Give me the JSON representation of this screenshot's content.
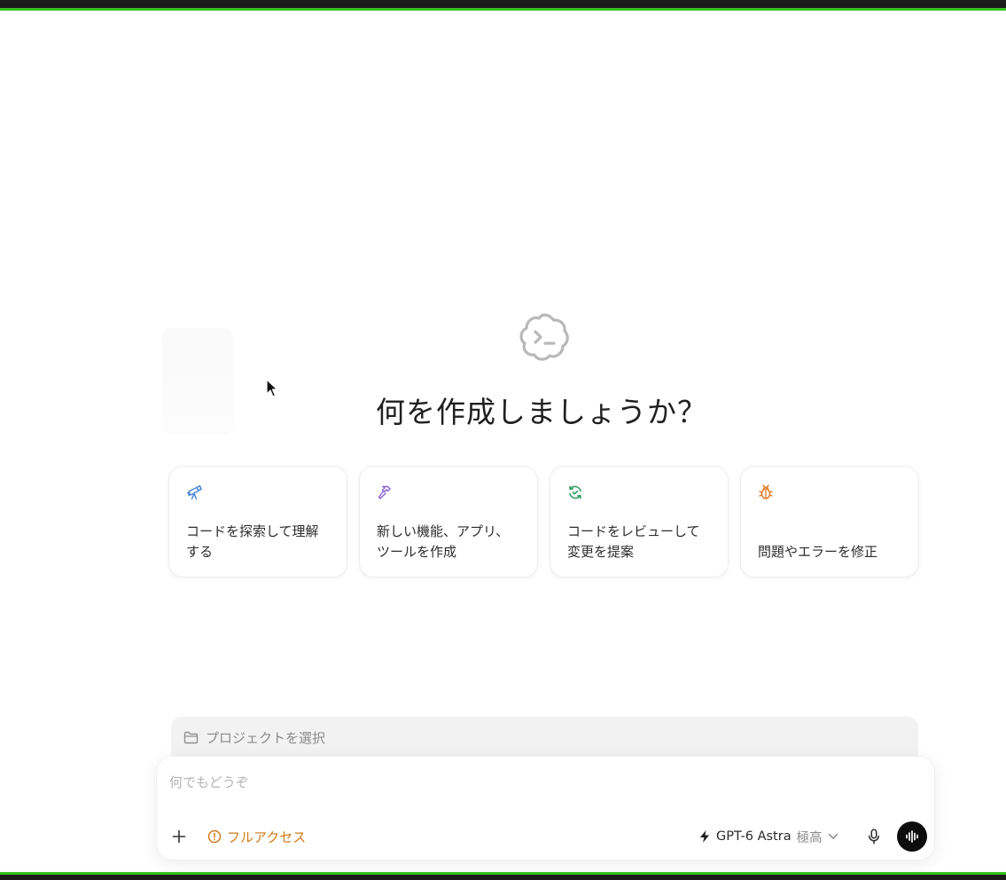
{
  "headline": "何を作成しましょうか？",
  "cards": [
    {
      "icon": "telescope-icon",
      "label": "コードを探索して理解\nする",
      "icon_color": "#4b86d6"
    },
    {
      "icon": "hammer-icon",
      "label": "新しい機能、アプリ、\nツールを作成",
      "icon_color": "#8a67d8"
    },
    {
      "icon": "review-refresh-icon",
      "label": "コードをレビューして\n変更を提案",
      "icon_color": "#2f9e66"
    },
    {
      "icon": "bug-icon",
      "label": "問題やエラーを修正",
      "icon_color": "#e07a22"
    }
  ],
  "project": {
    "label": "プロジェクトを選択",
    "icon": "folder-icon"
  },
  "composer": {
    "placeholder": "何でもどうぞ",
    "value": "",
    "access_label": "フルアクセス",
    "access_color": "#d07a1a",
    "model_name": "GPT-6 Astra",
    "model_effort": "極高"
  }
}
